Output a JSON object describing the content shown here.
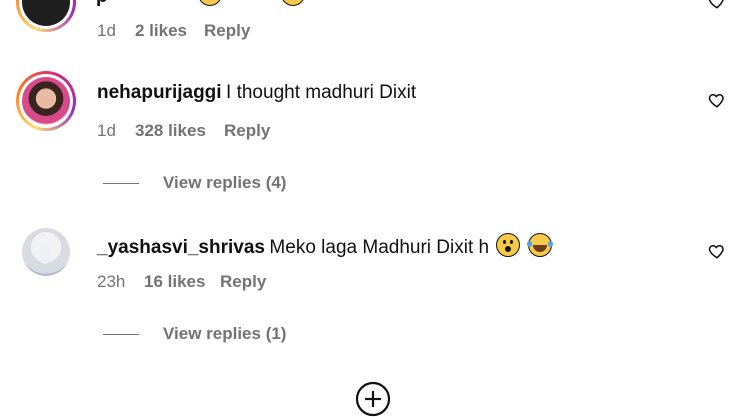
{
  "comments": [
    {
      "username": "p",
      "text": "",
      "time": "1d",
      "likes": "2 likes",
      "reply": "Reply"
    },
    {
      "username": "nehapurijaggi",
      "text": "I thought madhuri Dixit",
      "time": "1d",
      "likes": "328 likes",
      "reply": "Reply",
      "view_replies": "View replies (4)"
    },
    {
      "username": "_yashasvi_shrivas",
      "text": "Meko laga Madhuri Dixit h",
      "emojis": [
        "hushed-face",
        "laughing-tears-face"
      ],
      "time": "23h",
      "likes": "16 likes",
      "reply": "Reply",
      "view_replies": "View replies (1)"
    }
  ],
  "footer": {
    "icon": "add-circle-icon"
  },
  "colors": {
    "meta": "#737373",
    "text": "#111111"
  }
}
